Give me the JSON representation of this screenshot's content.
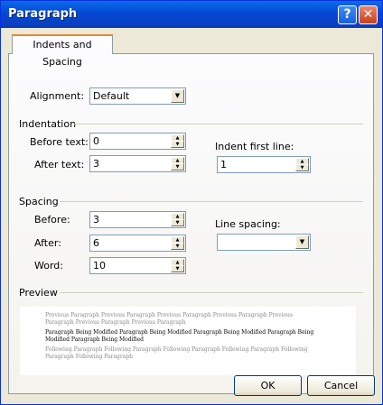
{
  "window": {
    "title": "Paragraph",
    "help_glyph": "?",
    "close_glyph": "✕"
  },
  "tabs": [
    {
      "label": "Indents and Spacing"
    }
  ],
  "alignment": {
    "label": "Alignment:",
    "value": "Default"
  },
  "indentation": {
    "heading": "Indentation",
    "before_text": {
      "label": "Before text:",
      "value": "0"
    },
    "after_text": {
      "label": "After text:",
      "value": "3"
    },
    "first_line": {
      "label": "Indent first line:",
      "value": "1"
    }
  },
  "spacing": {
    "heading": "Spacing",
    "before": {
      "label": "Before:",
      "value": "3"
    },
    "after": {
      "label": "After:",
      "value": "6"
    },
    "word": {
      "label": "Word:",
      "value": "10"
    },
    "line_spacing": {
      "label": "Line spacing:",
      "value": ""
    }
  },
  "preview": {
    "heading": "Preview",
    "previous": "Previous Paragraph Previous Paragraph Previous Paragraph Previous Paragraph Previous Paragraph Previous Paragraph Previous Paragraph",
    "current": "Paragraph Being Modified Paragraph Being Modified Paragraph Being Modified Paragraph Being Modified Paragraph Being Modified",
    "following": "Following Paragraph Following Paragraph Following Paragraph Following Paragraph Following Paragraph Following Paragraph"
  },
  "buttons": {
    "ok": "OK",
    "cancel": "Cancel"
  }
}
